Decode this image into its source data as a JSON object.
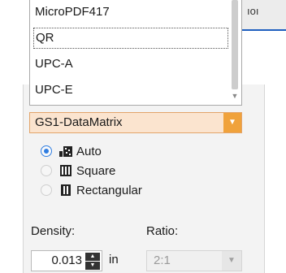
{
  "background_strip": {
    "text": "ıoı"
  },
  "symbology_list": {
    "items": [
      "MicroPDF417",
      "QR",
      "UPC-A",
      "UPC-E"
    ],
    "focused_item": "QR"
  },
  "symbology_combo": {
    "value": "GS1-DataMatrix",
    "accent_color": "#f0a23b"
  },
  "shape_options": [
    {
      "label": "Auto",
      "checked": true,
      "icon": "datamatrix-auto-icon"
    },
    {
      "label": "Square",
      "checked": false,
      "icon": "datamatrix-square-icon"
    },
    {
      "label": "Rectangular",
      "checked": false,
      "icon": "datamatrix-rectangular-icon"
    }
  ],
  "density": {
    "label": "Density:",
    "value": "0.013",
    "unit": "in"
  },
  "ratio": {
    "label": "Ratio:",
    "value": "2:1",
    "enabled": false
  }
}
